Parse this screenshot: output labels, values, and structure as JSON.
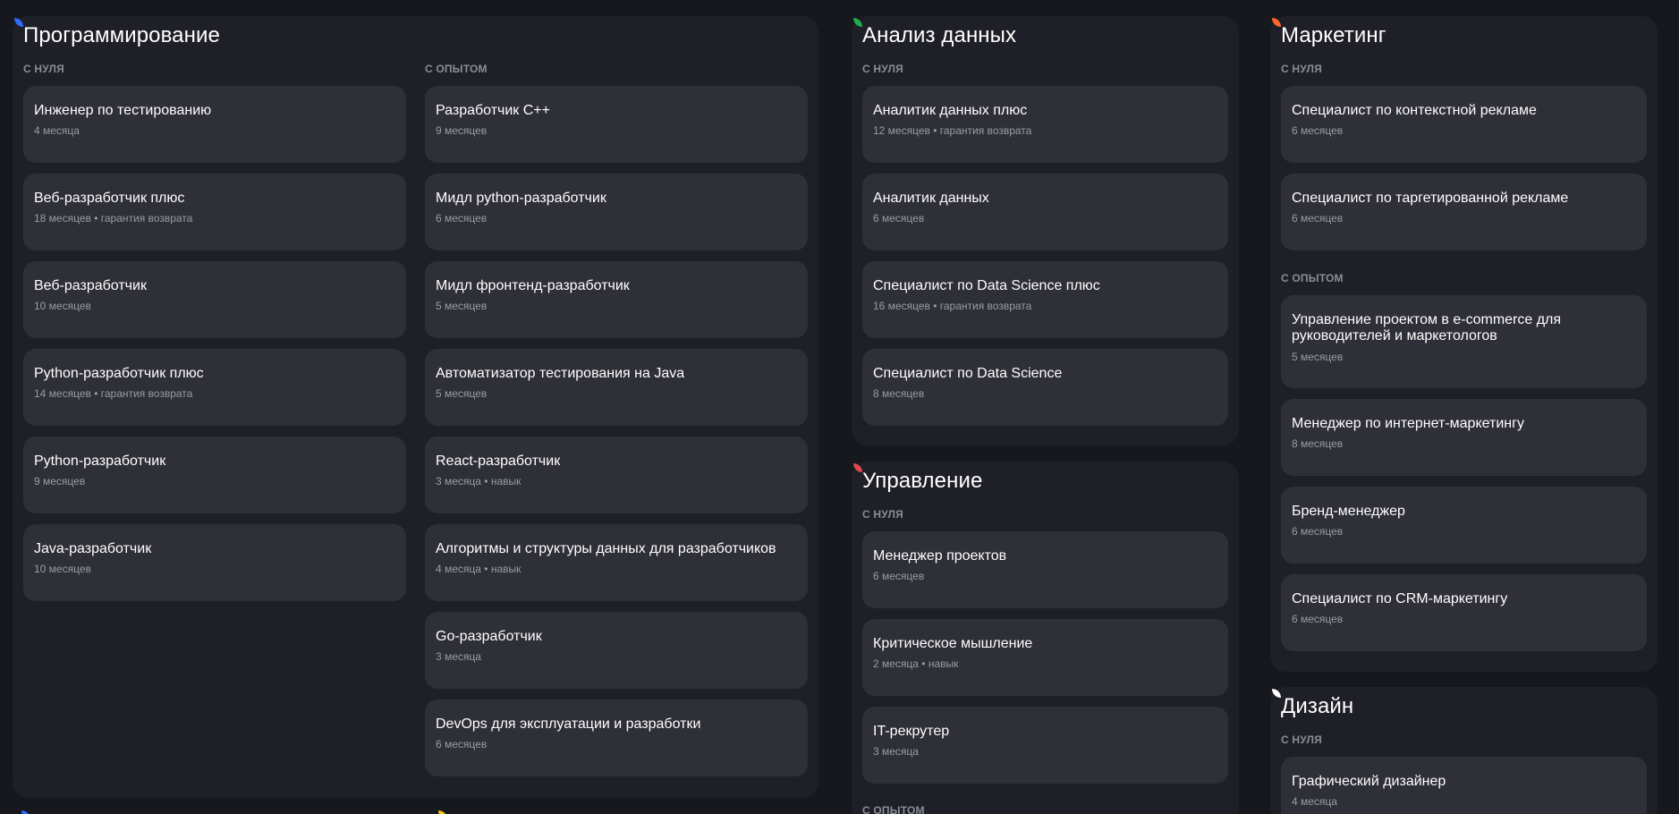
{
  "programming": {
    "title": "Программирование",
    "accent": "#2f6bff",
    "from_zero_label": "С НУЛЯ",
    "experienced_label": "С ОПЫТОМ",
    "from_zero": [
      {
        "title": "Инженер по тестированию",
        "meta": "4 месяца"
      },
      {
        "title": "Веб-разработчик плюс",
        "meta": "18 месяцев • гарантия возврата"
      },
      {
        "title": "Веб-разработчик",
        "meta": "10 месяцев"
      },
      {
        "title": "Python-разработчик плюс",
        "meta": "14 месяцев • гарантия возврата"
      },
      {
        "title": "Python-разработчик",
        "meta": "9 месяцев"
      },
      {
        "title": "Java-разработчик",
        "meta": "10 месяцев"
      }
    ],
    "experienced": [
      {
        "title": "Разработчик C++",
        "meta": "9 месяцев"
      },
      {
        "title": "Мидл python-разработчик",
        "meta": "6 месяцев"
      },
      {
        "title": "Мидл фронтенд-разработчик",
        "meta": "5 месяцев"
      },
      {
        "title": "Автоматизатор тестирования на Java",
        "meta": "5 месяцев"
      },
      {
        "title": "React-разработчик",
        "meta": "3 месяца • навык"
      },
      {
        "title": "Алгоритмы и структуры данных для разработчиков",
        "meta": "4 месяца • навык"
      },
      {
        "title": "Go-разработчик",
        "meta": "3 месяца"
      },
      {
        "title": "DevOps для эксплуатации и разработки",
        "meta": "6 месяцев"
      }
    ]
  },
  "data_analysis": {
    "title": "Анализ данных",
    "accent": "#1fae4b",
    "from_zero_label": "С НУЛЯ",
    "from_zero": [
      {
        "title": "Аналитик данных плюс",
        "meta": "12 месяцев • гарантия возврата"
      },
      {
        "title": "Аналитик данных",
        "meta": "6 месяцев"
      },
      {
        "title": "Специалист по Data Science плюс",
        "meta": "16 месяцев • гарантия возврата"
      },
      {
        "title": "Специалист по Data Science",
        "meta": "8 месяцев"
      }
    ]
  },
  "management": {
    "title": "Управление",
    "accent": "#e2474f",
    "from_zero_label": "С НУЛЯ",
    "experienced_label": "С ОПЫТОМ",
    "from_zero": [
      {
        "title": "Менеджер проектов",
        "meta": "6 месяцев"
      },
      {
        "title": "Критическое мышление",
        "meta": "2 месяца • навык"
      },
      {
        "title": "IT-рекрутер",
        "meta": "3 месяца"
      }
    ]
  },
  "marketing": {
    "title": "Маркетинг",
    "accent": "#ff6a2b",
    "from_zero_label": "С НУЛЯ",
    "experienced_label": "С ОПЫТОМ",
    "from_zero": [
      {
        "title": "Специалист по контекстной рекламе",
        "meta": "6 месяцев"
      },
      {
        "title": "Специалист по таргетированной рекламе",
        "meta": "6 месяцев"
      }
    ],
    "experienced": [
      {
        "title": "Управление проектом в e-commerce для руководителей и маркетологов",
        "meta": "5 месяцев"
      },
      {
        "title": "Менеджер по интернет-маркетингу",
        "meta": "8 месяцев"
      },
      {
        "title": "Бренд-менеджер",
        "meta": "6 месяцев"
      },
      {
        "title": "Специалист по CRM-маркетингу",
        "meta": "6 месяцев"
      }
    ]
  },
  "design": {
    "title": "Дизайн",
    "accent": "#ffffff",
    "from_zero_label": "С НУЛЯ",
    "from_zero": [
      {
        "title": "Графический дизайнер",
        "meta": "4 месяца"
      }
    ]
  },
  "bottom_leaf_colors": [
    "#2f6bff",
    "#f5c518"
  ]
}
